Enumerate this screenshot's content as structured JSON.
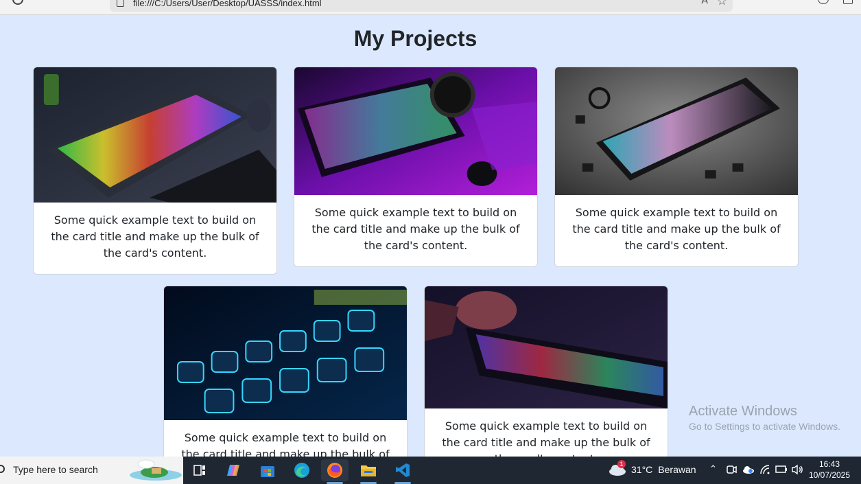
{
  "browser": {
    "url": "file:///C:/Users/User/Desktop/UASSS/index.html"
  },
  "page": {
    "title": "My Projects"
  },
  "cards": [
    {
      "text": "Some quick example text to build on the card title and make up the bulk of the card's content.",
      "image": "rgb-gaming-keyboard-desk"
    },
    {
      "text": "Some quick example text to build on the card title and make up the bulk of the card's content.",
      "image": "purple-keyboard-headset"
    },
    {
      "text": "Some quick example text to build on the card title and make up the bulk of the card's content.",
      "image": "compact-keyboard-on-concrete"
    },
    {
      "text": "Some quick example text to build on the card title and make up the bulk of the card's content.",
      "image": "blue-backlit-keys-closeup"
    },
    {
      "text": "Some quick example text to build on the card title and make up the bulk of the card's content.",
      "image": "hand-on-rgb-keyboard"
    }
  ],
  "watermark": {
    "title": "Activate Windows",
    "subtitle": "Go to Settings to activate Windows."
  },
  "taskbar": {
    "search_placeholder": "Type here to search",
    "weather_badge": "1",
    "temperature": "31°C",
    "condition": "Berawan",
    "time": "16:43",
    "date": "10/07/2025",
    "apps": [
      "task-view",
      "copilot",
      "microsoft-store",
      "edge",
      "firefox",
      "file-explorer",
      "vs-code"
    ]
  }
}
